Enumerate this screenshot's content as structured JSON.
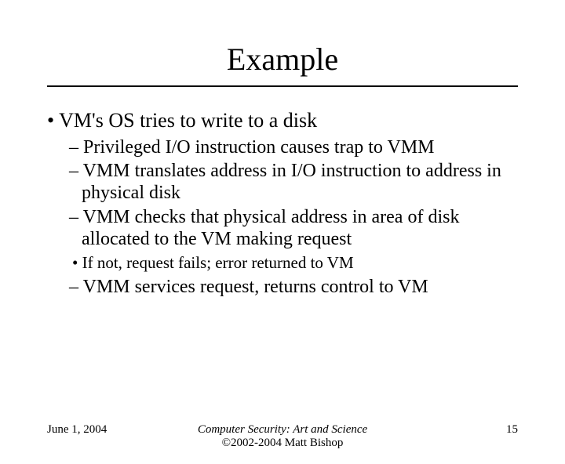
{
  "title": "Example",
  "bullets": {
    "main": "VM's OS tries to write to a disk",
    "sub1": "Privileged I/O instruction causes trap to VMM",
    "sub2": "VMM translates address in I/O instruction to address in physical disk",
    "sub3": "VMM checks that physical address in area of disk allocated to the VM making request",
    "sub3a": "If not, request fails; error returned to VM",
    "sub4": "VMM services request, returns control to VM"
  },
  "footer": {
    "date": "June 1, 2004",
    "source_title": "Computer Security: Art and Science",
    "copyright": "©2002-2004 Matt Bishop",
    "page": "15"
  }
}
